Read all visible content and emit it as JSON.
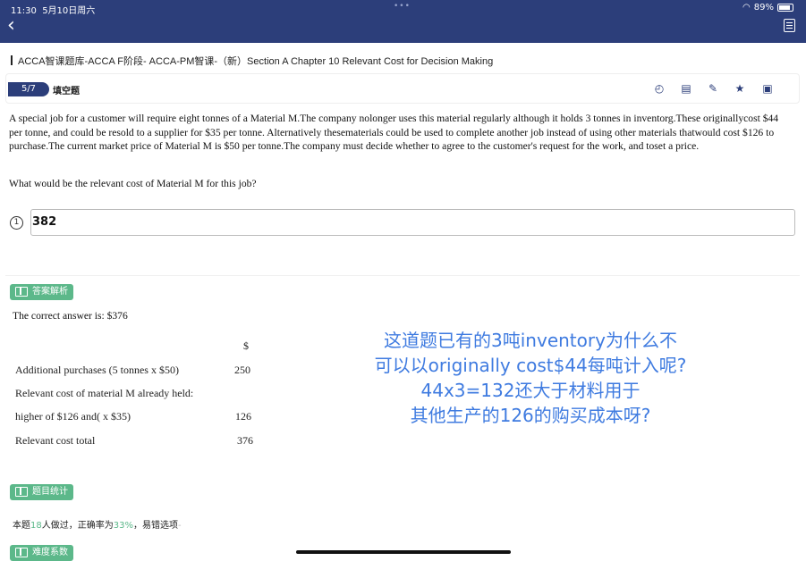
{
  "status": {
    "time": "11:30",
    "date": "5月10日周六",
    "battery": "89%"
  },
  "breadcrumb": "ACCA智课题库-ACCA F阶段- ACCA-PM智课-（新）Section A Chapter 10 Relevant Cost for Decision Making",
  "question_bar": {
    "number": "5/7",
    "type": "填空题"
  },
  "question": {
    "text": "A special job for a customer will require eight tonnes of a Material M.The company nolonger uses this material regularly although it holds 3 tonnes in inventorg.These originallycost $44 per tonne, and could be resold to a supplier for $35 per tonne. Alternatively thesematerials could be used to complete another job instead of using other materials thatwould cost $126 to purchase.The current market price of Material M is $50 per tonne.The company must decide whether to agree to the customer's request for the work, and toset a price.",
    "ask": "What would be the relevant cost of Material M for this job?",
    "answer_index": "1",
    "answer_value": "382"
  },
  "analysis": {
    "tag": "答案解析",
    "correct": "The correct answer is: $376",
    "currency_header": "$",
    "rows": [
      {
        "label": "Additional purchases (5 tonnes x $50)",
        "value": "250"
      },
      {
        "label": "Relevant cost of material M already held:",
        "value": ""
      },
      {
        "label": "higher of $126 and( x $35)",
        "value": "126"
      },
      {
        "label": "Relevant cost total",
        "value": "376"
      }
    ]
  },
  "note_lines": [
    "这道题已有的3吨inventory为什么不",
    "可以以originally cost$44每吨计入呢?",
    "44x3=132还大于材料用于",
    "其他生产的126的购买成本呀?"
  ],
  "stats": {
    "tag": "题目统计",
    "prefix": "本题",
    "count": "18",
    "mid": "人做过，正确率为",
    "rate": "33%",
    "suffix": "，易错选项",
    "tail": "-"
  },
  "difficulty": {
    "tag": "难度系数"
  },
  "colors": {
    "nav": "#2c3e7a",
    "accent_green": "#5cb88a",
    "note_blue": "#3f7be0"
  }
}
